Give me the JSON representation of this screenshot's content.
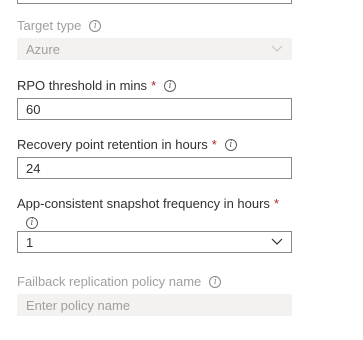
{
  "target_type": {
    "label": "Target type",
    "value": "Azure"
  },
  "rpo_threshold": {
    "label": "RPO threshold in mins",
    "required_mark": "*",
    "value": "60"
  },
  "recovery_retention": {
    "label": "Recovery point retention in hours",
    "required_mark": "*",
    "value": "24"
  },
  "app_snapshot": {
    "label": "App-consistent snapshot frequency in hours",
    "required_mark": "*",
    "value": "1"
  },
  "failback_policy": {
    "label": "Failback replication policy name",
    "placeholder": "Enter policy name"
  },
  "icons": {
    "info": "info-icon",
    "chevron": "chevron-down-icon"
  }
}
